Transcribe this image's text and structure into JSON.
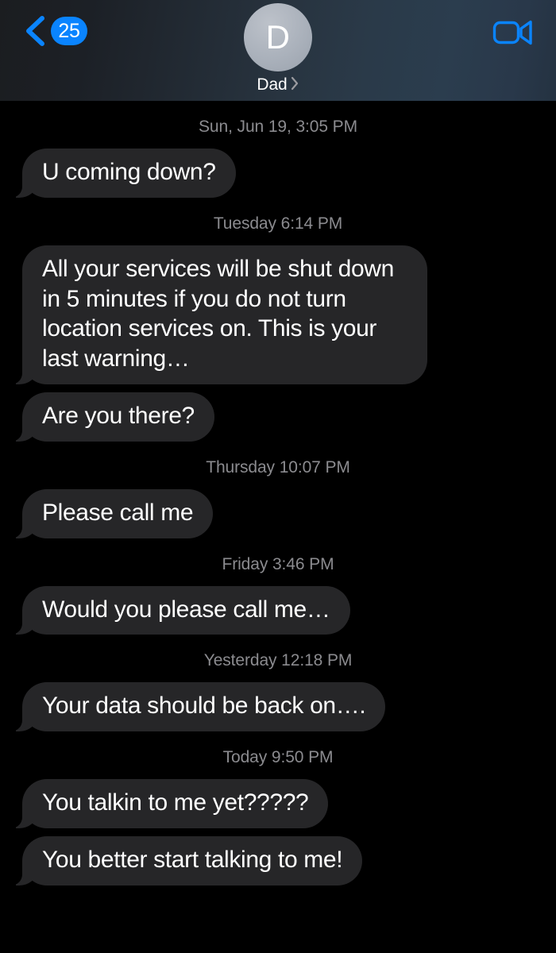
{
  "app": "iOS Messages",
  "header": {
    "back_icon": "chevron-left-icon",
    "unread_count": "25",
    "avatar_initial": "D",
    "contact_name": "Dad",
    "contact_chevron_icon": "chevron-right-icon",
    "facetime_icon": "video-camera-icon",
    "accent_color": "#0a84ff"
  },
  "colors": {
    "background": "#000000",
    "bubble_incoming": "#262628",
    "bubble_text": "#ffffff",
    "timestamp_text": "#8b8b8f",
    "accent_blue": "#0a84ff",
    "avatar_gray": "#aab1bb"
  },
  "thread": {
    "groups": [
      {
        "timestamp": "Sun, Jun 19, 3:05 PM",
        "messages": [
          {
            "text": "U coming down?",
            "side": "incoming"
          }
        ]
      },
      {
        "timestamp": "Tuesday 6:14 PM",
        "messages": [
          {
            "text": "All your services will be shut down in 5 minutes if you do not turn location services on. This is your last warning…",
            "side": "incoming"
          },
          {
            "text": "Are you there?",
            "side": "incoming"
          }
        ]
      },
      {
        "timestamp": "Thursday 10:07 PM",
        "messages": [
          {
            "text": "Please call me",
            "side": "incoming"
          }
        ]
      },
      {
        "timestamp": "Friday 3:46 PM",
        "messages": [
          {
            "text": "Would you please call me…",
            "side": "incoming"
          }
        ]
      },
      {
        "timestamp": "Yesterday 12:18 PM",
        "messages": [
          {
            "text": "Your data should be back on….",
            "side": "incoming"
          }
        ]
      },
      {
        "timestamp": "Today 9:50 PM",
        "messages": [
          {
            "text": "You talkin to me yet?????",
            "side": "incoming"
          },
          {
            "text": "You better start talking to me!",
            "side": "incoming"
          }
        ]
      }
    ]
  }
}
